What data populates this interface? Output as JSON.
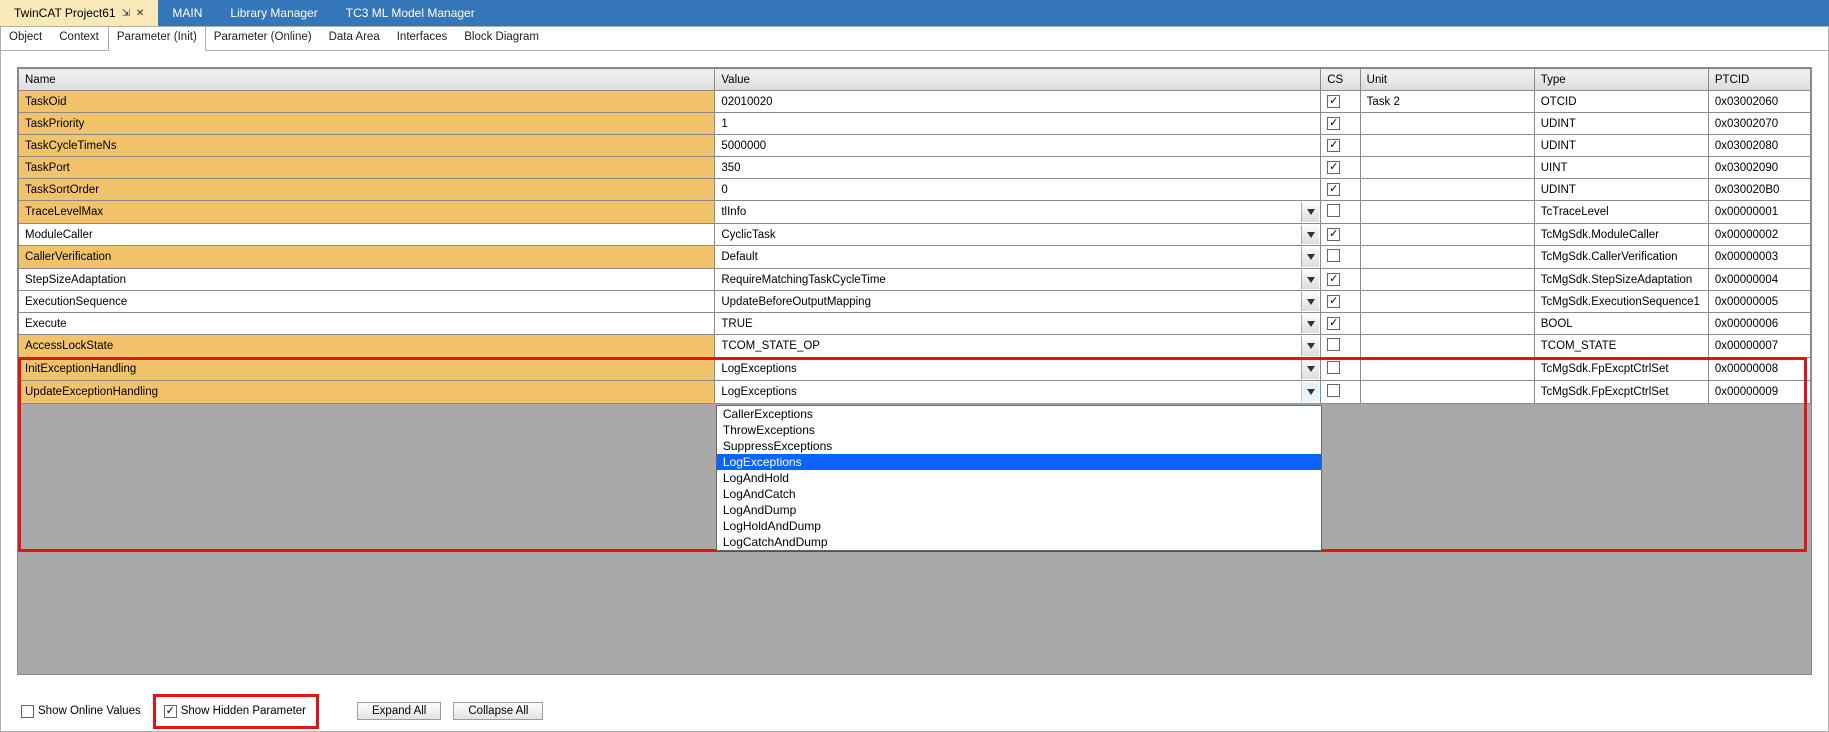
{
  "window_tabs": [
    {
      "label": "TwinCAT Project61",
      "active": true,
      "pinned": true,
      "closeable": true
    },
    {
      "label": "MAIN",
      "active": false
    },
    {
      "label": "Library Manager",
      "active": false
    },
    {
      "label": "TC3 ML Model Manager",
      "active": false
    }
  ],
  "sub_tabs": [
    {
      "label": "Object",
      "active": false
    },
    {
      "label": "Context",
      "active": false
    },
    {
      "label": "Parameter (Init)",
      "active": true
    },
    {
      "label": "Parameter (Online)",
      "active": false
    },
    {
      "label": "Data Area",
      "active": false
    },
    {
      "label": "Interfaces",
      "active": false
    },
    {
      "label": "Block Diagram",
      "active": false
    }
  ],
  "columns": {
    "name": "Name",
    "value": "Value",
    "cs": "CS",
    "unit": "Unit",
    "type": "Type",
    "ptcid": "PTCID"
  },
  "rows": [
    {
      "name": "TaskOid",
      "highlight": true,
      "value": "02010020",
      "dropdown": false,
      "cs": true,
      "unit": "Task 2",
      "type": "OTCID",
      "ptcid": "0x03002060"
    },
    {
      "name": "TaskPriority",
      "highlight": true,
      "value": "1",
      "dropdown": false,
      "cs": true,
      "unit": "",
      "type": "UDINT",
      "ptcid": "0x03002070"
    },
    {
      "name": "TaskCycleTimeNs",
      "highlight": true,
      "value": "5000000",
      "dropdown": false,
      "cs": true,
      "unit": "",
      "type": "UDINT",
      "ptcid": "0x03002080"
    },
    {
      "name": "TaskPort",
      "highlight": true,
      "value": "350",
      "dropdown": false,
      "cs": true,
      "unit": "",
      "type": "UINT",
      "ptcid": "0x03002090"
    },
    {
      "name": "TaskSortOrder",
      "highlight": true,
      "value": "0",
      "dropdown": false,
      "cs": true,
      "unit": "",
      "type": "UDINT",
      "ptcid": "0x030020B0"
    },
    {
      "name": "TraceLevelMax",
      "highlight": true,
      "value": "tlInfo",
      "dropdown": true,
      "cs": false,
      "unit": "",
      "type": "TcTraceLevel",
      "ptcid": "0x00000001"
    },
    {
      "name": "ModuleCaller",
      "highlight": false,
      "value": "CyclicTask",
      "dropdown": true,
      "cs": true,
      "unit": "",
      "type": "TcMgSdk.ModuleCaller",
      "ptcid": "0x00000002"
    },
    {
      "name": "CallerVerification",
      "highlight": true,
      "value": "Default",
      "dropdown": true,
      "cs": false,
      "unit": "",
      "type": "TcMgSdk.CallerVerification",
      "ptcid": "0x00000003"
    },
    {
      "name": "StepSizeAdaptation",
      "highlight": false,
      "value": "RequireMatchingTaskCycleTime",
      "dropdown": true,
      "cs": true,
      "unit": "",
      "type": "TcMgSdk.StepSizeAdaptation",
      "ptcid": "0x00000004"
    },
    {
      "name": "ExecutionSequence",
      "highlight": false,
      "value": "UpdateBeforeOutputMapping",
      "dropdown": true,
      "cs": true,
      "unit": "",
      "type": "TcMgSdk.ExecutionSequence1",
      "ptcid": "0x00000005"
    },
    {
      "name": "Execute",
      "highlight": false,
      "value": "TRUE",
      "dropdown": true,
      "cs": true,
      "unit": "",
      "type": "BOOL",
      "ptcid": "0x00000006"
    },
    {
      "name": "AccessLockState",
      "highlight": true,
      "value": "TCOM_STATE_OP",
      "dropdown": true,
      "cs": false,
      "unit": "",
      "type": "TCOM_STATE",
      "ptcid": "0x00000007"
    },
    {
      "name": "InitExceptionHandling",
      "highlight": true,
      "value": "LogExceptions",
      "dropdown": true,
      "cs": false,
      "unit": "",
      "type": "TcMgSdk.FpExcptCtrlSet",
      "ptcid": "0x00000008"
    },
    {
      "name": "UpdateExceptionHandling",
      "highlight": true,
      "value": "LogExceptions",
      "dropdown": true,
      "dropdown_open": true,
      "cs": false,
      "unit": "",
      "type": "TcMgSdk.FpExcptCtrlSet",
      "ptcid": "0x00000009"
    }
  ],
  "dropdown_options": [
    {
      "label": "CallerExceptions",
      "selected": false
    },
    {
      "label": "ThrowExceptions",
      "selected": false
    },
    {
      "label": "SuppressExceptions",
      "selected": false
    },
    {
      "label": "LogExceptions",
      "selected": true
    },
    {
      "label": "LogAndHold",
      "selected": false
    },
    {
      "label": "LogAndCatch",
      "selected": false
    },
    {
      "label": "LogAndDump",
      "selected": false
    },
    {
      "label": "LogHoldAndDump",
      "selected": false
    },
    {
      "label": "LogCatchAndDump",
      "selected": false
    }
  ],
  "footer": {
    "show_online_values": {
      "label": "Show Online Values",
      "checked": false
    },
    "show_hidden_parameter": {
      "label": "Show Hidden Parameter",
      "checked": true
    },
    "expand_all": "Expand All",
    "collapse_all": "Collapse All"
  }
}
